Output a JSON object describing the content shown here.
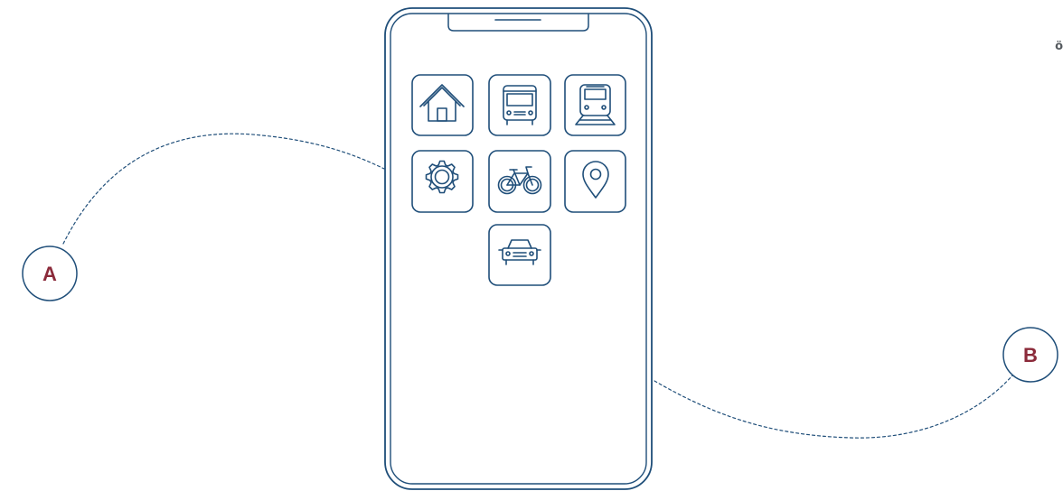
{
  "colors": {
    "line": "#1f4e79",
    "accent": "#8b2a3a",
    "dash": "#1f4e79",
    "corner_text": "#555a5f"
  },
  "nodes": {
    "a": {
      "label": "A"
    },
    "b": {
      "label": "B"
    }
  },
  "corner_text": "ö",
  "apps": [
    {
      "name": "home",
      "icon": "home-icon"
    },
    {
      "name": "bus",
      "icon": "bus-icon"
    },
    {
      "name": "train",
      "icon": "train-icon"
    },
    {
      "name": "settings",
      "icon": "gear-icon"
    },
    {
      "name": "bicycle",
      "icon": "bicycle-icon"
    },
    {
      "name": "location",
      "icon": "map-pin-icon"
    },
    {
      "name": "car",
      "icon": "car-icon"
    }
  ]
}
